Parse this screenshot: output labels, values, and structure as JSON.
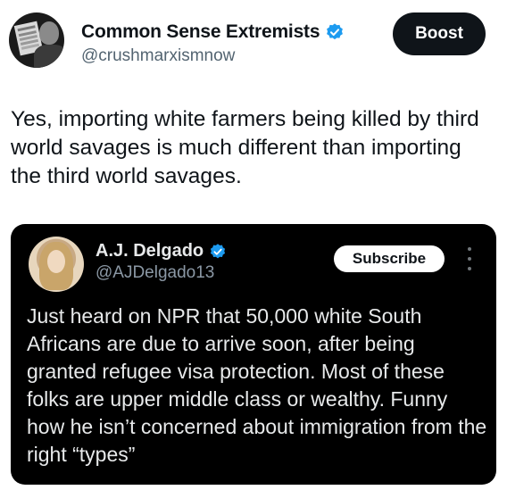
{
  "post": {
    "author": {
      "display_name": "Common Sense Extremists",
      "handle": "@crushmarxismnow",
      "verified_color": "#1d9bf0"
    },
    "boost_label": "Boost",
    "text": "Yes, importing white farmers being killed by third world savages is much different than importing the third world savages."
  },
  "quoted_post": {
    "author": {
      "display_name": "A.J. Delgado",
      "handle": "@AJDelgado13",
      "verified_color": "#1d9bf0"
    },
    "subscribe_label": "Subscribe",
    "more_icon": "more-vertical-icon",
    "text": "Just heard on NPR that 50,000 white South Africans are due to arrive soon, after being granted refugee visa protection. Most of these folks are upper middle class or wealthy. Funny how he isn’t concerned about immigration from the right “types”"
  }
}
